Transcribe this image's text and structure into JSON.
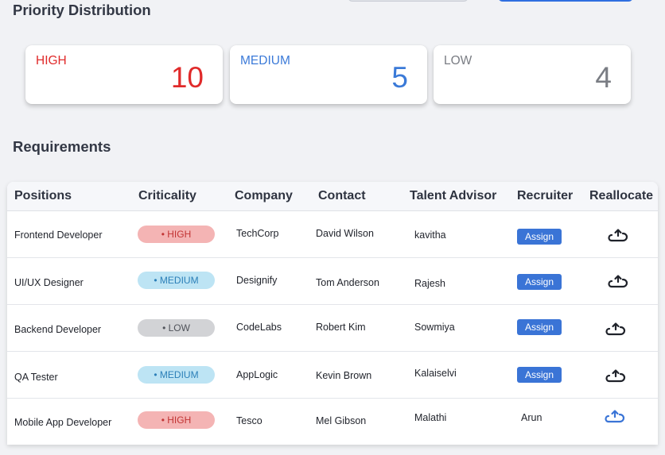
{
  "priority": {
    "title": "Priority Distribution",
    "cards": [
      {
        "label": "HIGH",
        "count": "10",
        "color": "#e02a2a"
      },
      {
        "label": "MEDIUM",
        "count": "5",
        "color": "#3b7ad8"
      },
      {
        "label": "LOW",
        "count": "4",
        "color": "#7a7d84"
      }
    ]
  },
  "requirements": {
    "title": "Requirements",
    "columns": [
      "Positions",
      "Criticality",
      "Company",
      "Contact",
      "Talent Advisor",
      "Recruiter",
      "Reallocate"
    ],
    "rows": [
      {
        "position": "Frontend Developer",
        "criticality": "• HIGH",
        "level": "high",
        "company": "TechCorp",
        "contact": "David Wilson",
        "advisor": "kavitha",
        "recruiter": "Assign",
        "recruiter_is_button": true,
        "reallocate_icon": "reallocate-icon"
      },
      {
        "position": "UI/UX Designer",
        "criticality": "• MEDIUM",
        "level": "medium",
        "company": "Designify",
        "contact": "Tom Anderson",
        "advisor": "Rajesh",
        "recruiter": "Assign",
        "recruiter_is_button": true,
        "reallocate_icon": "reallocate-icon"
      },
      {
        "position": "Backend Developer",
        "criticality": "• LOW",
        "level": "low",
        "company": "CodeLabs",
        "contact": "Robert Kim",
        "advisor": "Sowmiya",
        "recruiter": "Assign",
        "recruiter_is_button": true,
        "reallocate_icon": "reallocate-icon"
      },
      {
        "position": "QA Tester",
        "criticality": "• MEDIUM",
        "level": "medium",
        "company": "AppLogic",
        "contact": "Kevin Brown",
        "advisor": "Kalaiselvi",
        "recruiter": "Assign",
        "recruiter_is_button": true,
        "reallocate_icon": "reallocate-icon"
      },
      {
        "position": "Mobile App Developer",
        "criticality": "• HIGH",
        "level": "high",
        "company": "Tesco",
        "contact": "Mel Gibson",
        "advisor": "Malathi",
        "recruiter": "Arun",
        "recruiter_is_button": false,
        "reallocate_icon": "reallocate-icon"
      }
    ]
  },
  "colors": {
    "accent": "#3a74d6",
    "high": "#e02a2a",
    "medium": "#3b7ad8",
    "low": "#7a7d84",
    "reallocate_active": "#3a74d6"
  }
}
